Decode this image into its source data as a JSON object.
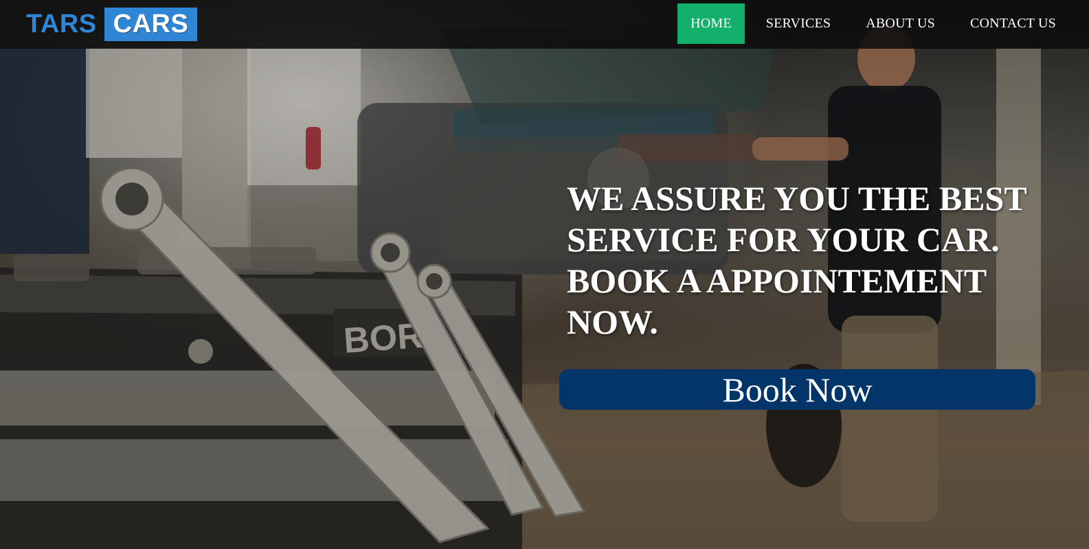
{
  "brand": {
    "part1": "TARS",
    "part2": "CARS"
  },
  "nav": {
    "items": [
      {
        "label": "HOME",
        "active": true
      },
      {
        "label": "SERVICES",
        "active": false
      },
      {
        "label": "ABOUT US",
        "active": false
      },
      {
        "label": "CONTACT US",
        "active": false
      }
    ]
  },
  "hero": {
    "headline": "WE ASSURE YOU THE BEST SERVICE FOR YOUR CAR. BOOK A APPOINTEMENT NOW.",
    "button_label": "Book Now",
    "background_image": "garage-tools-hero-image"
  },
  "colors": {
    "brand_blue": "#2f86d6",
    "nav_active": "#13b06b",
    "button_bg": "#03356b",
    "navbar_bg": "#0c0c0c",
    "text": "#ffffff"
  }
}
